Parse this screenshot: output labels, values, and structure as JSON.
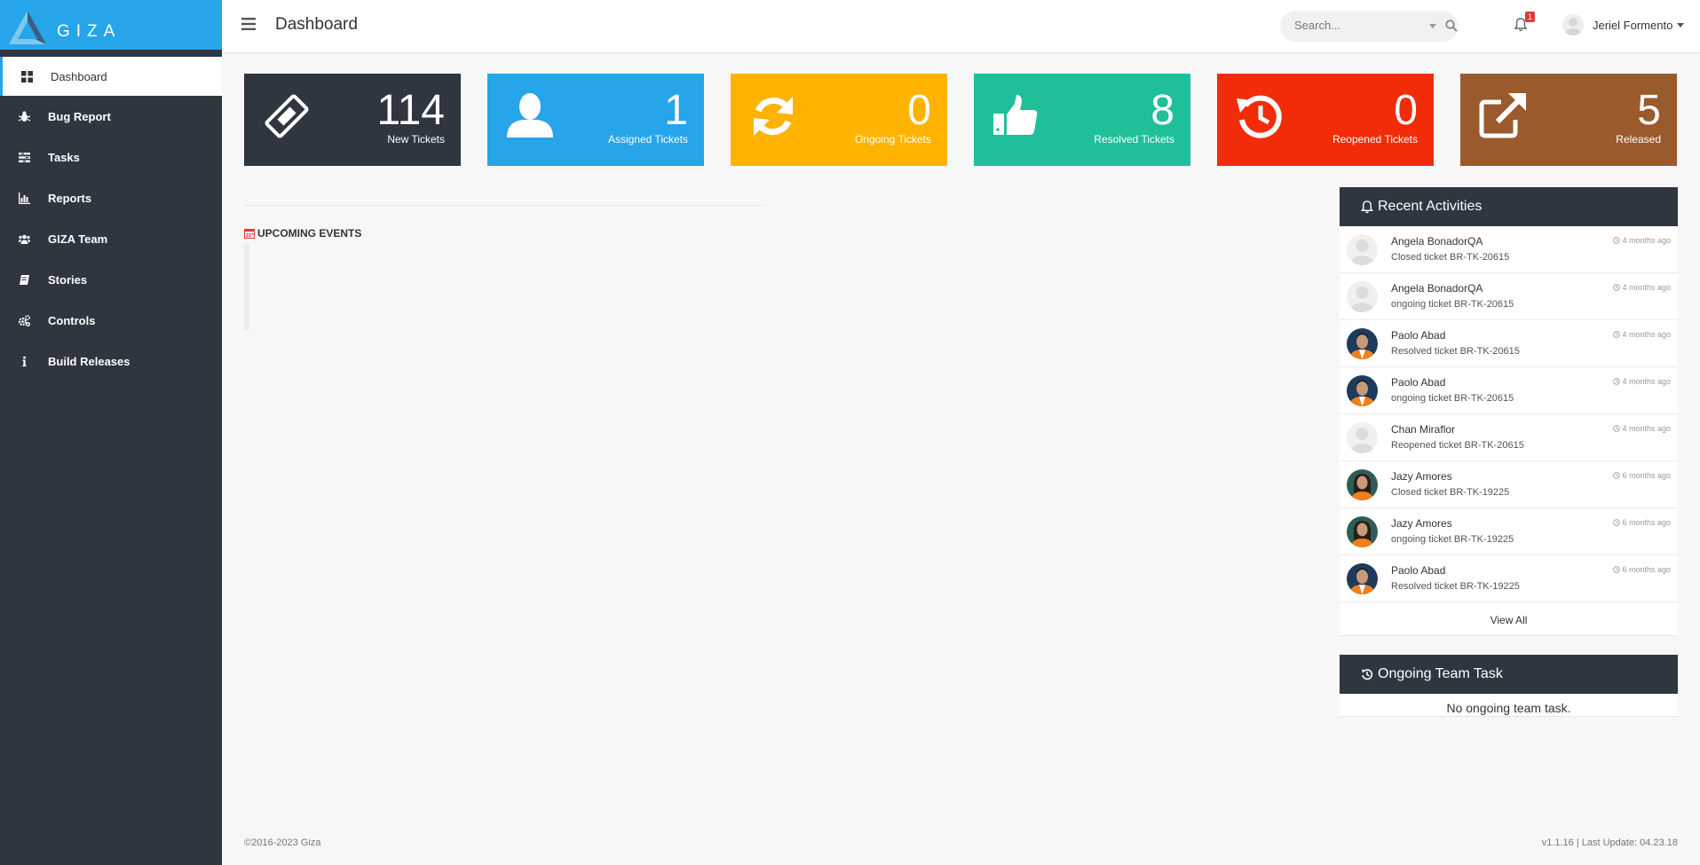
{
  "brand": {
    "name": "GIZA"
  },
  "sidebar": {
    "items": [
      {
        "label": "Dashboard",
        "icon": "dashboard-icon"
      },
      {
        "label": "Bug Report",
        "icon": "bug-icon"
      },
      {
        "label": "Tasks",
        "icon": "tasks-icon"
      },
      {
        "label": "Reports",
        "icon": "bar-chart-icon"
      },
      {
        "label": "GIZA Team",
        "icon": "users-icon"
      },
      {
        "label": "Stories",
        "icon": "book-icon"
      },
      {
        "label": "Controls",
        "icon": "cogs-icon"
      },
      {
        "label": "Build Releases",
        "icon": "info-icon"
      }
    ]
  },
  "header": {
    "title": "Dashboard",
    "search_placeholder": "Search...",
    "notification_count": "1",
    "user_name": "Jeriel Formento"
  },
  "stats": [
    {
      "value": "114",
      "label": "New Tickets",
      "color": "#2f3640",
      "icon": "ticket-icon"
    },
    {
      "value": "1",
      "label": "Assigned Tickets",
      "color": "#26a5ea",
      "icon": "user-icon"
    },
    {
      "value": "0",
      "label": "Ongoing Tickets",
      "color": "#ffb300",
      "icon": "refresh-icon"
    },
    {
      "value": "8",
      "label": "Resolved Tickets",
      "color": "#1fbf9a",
      "icon": "thumbs-up-icon"
    },
    {
      "value": "0",
      "label": "Reopened Tickets",
      "color": "#f22c08",
      "icon": "history-icon"
    },
    {
      "value": "5",
      "label": "Released",
      "color": "#9b5a2c",
      "icon": "external-link-icon"
    }
  ],
  "events": {
    "title": "UPCOMING EVENTS"
  },
  "activities": {
    "title": "Recent Activities",
    "items": [
      {
        "name": "Angela BonadorQA",
        "action": "Closed ticket BR-TK-20615",
        "time": "4 months ago",
        "avatar": "placeholder"
      },
      {
        "name": "Angela BonadorQA",
        "action": "ongoing ticket BR-TK-20615",
        "time": "4 months ago",
        "avatar": "placeholder"
      },
      {
        "name": "Paolo Abad",
        "action": "Resolved ticket BR-TK-20615",
        "time": "4 months ago",
        "avatar": "male"
      },
      {
        "name": "Paolo Abad",
        "action": "ongoing ticket BR-TK-20615",
        "time": "4 months ago",
        "avatar": "male"
      },
      {
        "name": "Chan Miraflor",
        "action": "Reopened ticket BR-TK-20615",
        "time": "4 months ago",
        "avatar": "placeholder"
      },
      {
        "name": "Jazy Amores",
        "action": "Closed ticket BR-TK-19225",
        "time": "6 months ago",
        "avatar": "female"
      },
      {
        "name": "Jazy Amores",
        "action": "ongoing ticket BR-TK-19225",
        "time": "6 months ago",
        "avatar": "female"
      },
      {
        "name": "Paolo Abad",
        "action": "Resolved ticket BR-TK-19225",
        "time": "6 months ago",
        "avatar": "male"
      }
    ],
    "view_all": "View All"
  },
  "team_task": {
    "title": "Ongoing Team Task",
    "empty": "No ongoing team task."
  },
  "footer": {
    "copyright": "©2016-2023 Giza",
    "version": "v1.1.16 | Last Update: 04.23.18"
  }
}
